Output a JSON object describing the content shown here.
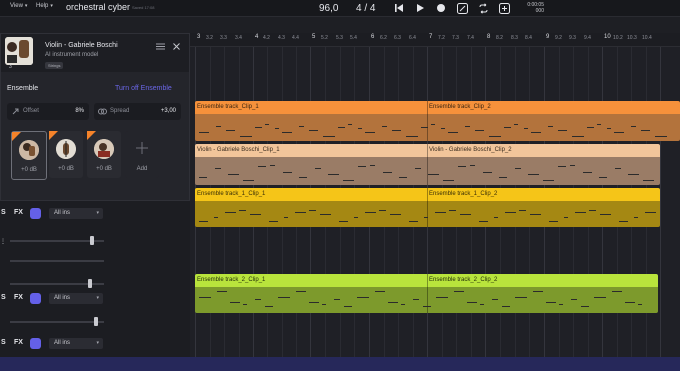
{
  "menu": {
    "view": "View",
    "help": "Help",
    "caret": "▾"
  },
  "project": {
    "title": "orchestral cyber",
    "saved": "Saved 17:08"
  },
  "transport": {
    "tempo": "96,0",
    "signature_num": "4",
    "signature_sep": "/",
    "signature_den": "4",
    "time_main": "0:00:05",
    "time_sub": "000"
  },
  "ruler": {
    "bars": [
      "3",
      "4",
      "5",
      "6",
      "7",
      "8",
      "9",
      "10"
    ],
    "sub": [
      ".2",
      ".3",
      ".4"
    ],
    "bar3_label": "3",
    "bar10_labels": [
      "10.2",
      "10.3",
      "10.4"
    ]
  },
  "panel": {
    "name": "Violin - Gabriele Boschi",
    "subtitle": "AI instrument model",
    "tag": "Strings",
    "count": "3",
    "ensemble_label": "Ensemble",
    "turn_off": "Turn off Ensemble",
    "offset_label": "Offset",
    "offset_value": "8%",
    "spread_label": "Spread",
    "spread_value": "+3,00",
    "slot_db": "+0 dB",
    "add_label": "Add"
  },
  "tracks": {
    "solo": "S",
    "fx": "FX",
    "input": "All ins",
    "caret": "▾"
  },
  "clips": [
    {
      "name": "Ensemble track_Clip_1"
    },
    {
      "name": "Ensemble track_Clip_2"
    },
    {
      "name": "Violin - Gabriele Boschi_Clip_1"
    },
    {
      "name": "Violin - Gabriele Boschi_Clip_2"
    },
    {
      "name": "Ensemble track_1_Clip_1"
    },
    {
      "name": "Ensemble track_1_Clip_2"
    },
    {
      "name": "Ensemble track_2_Clip_1"
    },
    {
      "name": "Ensemble track_2_Clip_2"
    }
  ],
  "colors": {
    "orange": "#f6913b",
    "peach": "#f2c59a",
    "yellow": "#f5c518",
    "lime": "#b9e43c",
    "accent": "#6460e8"
  }
}
